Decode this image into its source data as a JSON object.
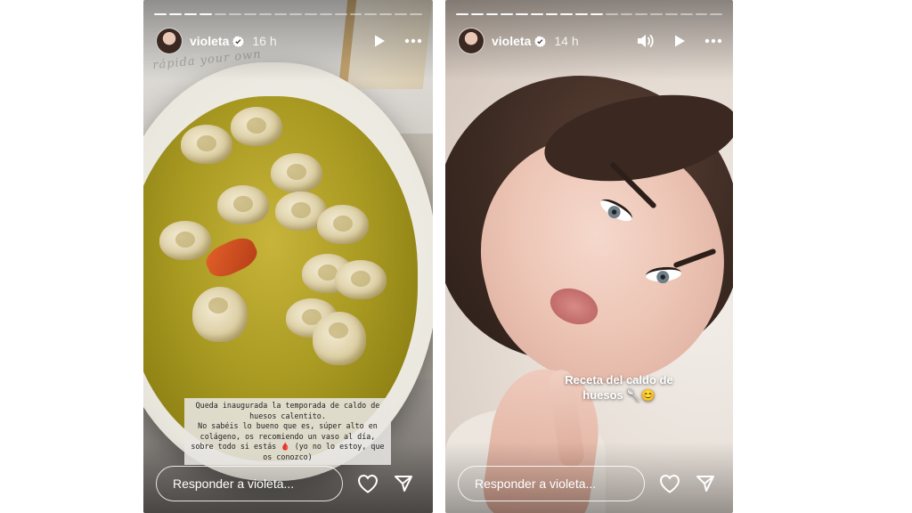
{
  "stories": [
    {
      "username": "violeta",
      "time": "16 h",
      "progress": {
        "segments": 18,
        "viewed": 4
      },
      "caption": "Queda inaugurada la temporada de caldo de huesos calentito.\nNo sabéis lo bueno que es, súper alto en colágeno, os recomiendo un vaso al día, sobre todo si estás 🩸 (yo no lo estoy, que os conozco)",
      "reply_placeholder": "Responder a violeta...",
      "controls": [
        "play-icon",
        "more-icon"
      ]
    },
    {
      "username": "violeta",
      "time": "14 h",
      "progress": {
        "segments": 18,
        "viewed": 10
      },
      "caption": "Receta del caldo de huesos 🥄😊",
      "reply_placeholder": "Responder a violeta...",
      "controls": [
        "volume-icon",
        "play-icon",
        "more-icon"
      ]
    }
  ],
  "colors": {
    "text": "#ffffff",
    "verified": "#ffffff"
  }
}
